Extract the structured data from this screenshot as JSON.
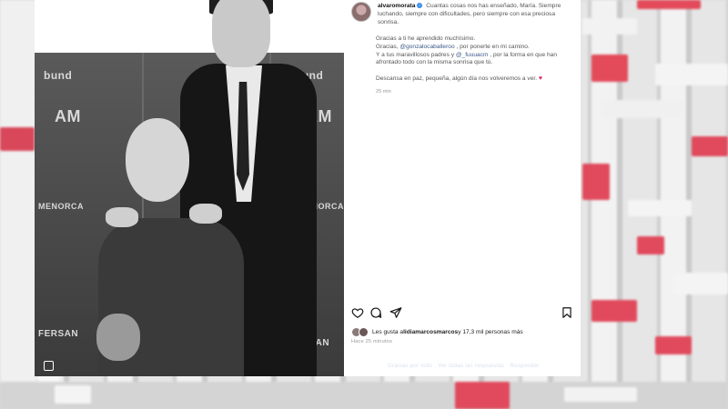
{
  "post": {
    "username": "alvaromorata",
    "caption_line": "Cuantas cosas nos has enseñado, María. Siempre luchando, siempre con dificultades, pero siempre con esa preciosa sonrisa.",
    "para1": "Gracias a ti he aprendido muchísimo.",
    "para2_start": "Gracias, ",
    "mention1": "@gonzalocaballeroo",
    "para2_end": " , por ponerte en mi camino.",
    "para3_start": "Y a tus maravillosos padres y ",
    "mention2": "@_fuuuacm",
    "para3_end": " , por la forma en que han afrontado todo con la misma sonrisa que tú.",
    "para4": "Descansa en paz, pequeña, algún día nos volveremos a ver.",
    "caption_time": "25 min",
    "likes_prefix": "Les gusta a ",
    "likes_user": "lidiamarcosmarcos",
    "likes_suffix": " y 17,3 mil personas más",
    "posted_ago": "Hace 25 minutos",
    "footer_text": "Gracias por todo · Ver todas las respuestas · Responder"
  },
  "photo": {
    "logos": [
      "bund",
      "AM",
      "MENORCA",
      "FERSAN",
      "bund",
      "AM",
      "MENORCA",
      "FERSAN"
    ]
  },
  "icons": [
    "verified-badge",
    "heart-icon",
    "comment-icon",
    "share-icon",
    "save-icon",
    "gallery-icon"
  ],
  "colors": {
    "accent_heart": "#e0245e",
    "verified": "#3a8ef0",
    "mention": "#3a5a8a"
  }
}
